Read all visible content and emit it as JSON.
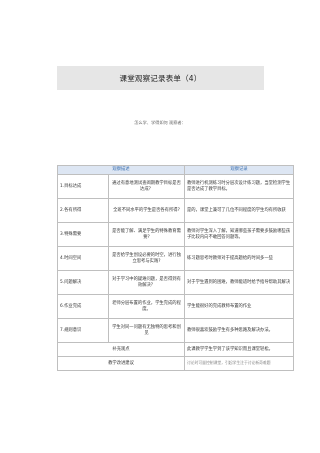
{
  "document": {
    "title": "课堂观察记录表单（4）",
    "meta_line": "怎么学、学得如何  观察者："
  },
  "table": {
    "headers": [
      "观察描述",
      "",
      "观察记录"
    ],
    "rows": [
      {
        "dimension": "1.目标达成",
        "question": "通过有意地测试查阅期教学目标是否达成？",
        "record": "教师进行机测练习时分层次设计练习题，当堂检测学生是否达成了教学目标。"
      },
      {
        "dimension": "2.各有所得",
        "question": "全班不同水平的学生是否各有所得?",
        "record": "是的，课堂上兼可了几位不同程度的学生均有所收获"
      },
      {
        "dimension": "3.特殊需要",
        "question": "是否能了解、满足学生的特殊教育需要?",
        "record": "教师对学生深入了解，知道哪些孩子需要多鼓励哪些孩子比较内向不敢回答问题等。"
      },
      {
        "dimension": "4.时间空间",
        "question": "是否给学生创设必要的时空，进行独立思考与实践?",
        "record": "练习题思考时教师对于提高题给的时间多一些"
      },
      {
        "dimension": "5.问题解决",
        "question": "对于学习中的疑难问题，是否得到有效解决？",
        "record": "对于学生遇到的困难，教师能适时给予指导帮助其解决"
      },
      {
        "dimension": "6.作业完成",
        "question": "老师分层布置的作业，学生完成的程度。",
        "record": "学生能很好的完成教师布置的作业"
      },
      {
        "dimension": "7.规则意识",
        "question": "学生对同一问题有无独特的思考和创见",
        "record": "教师很喜欢鼓励学生有多种思路及解决办法。"
      }
    ],
    "footer_rows": [
      {
        "label": "补充观点",
        "record": "此课教学学生学到了该学知识而且课堂轻松。"
      },
      {
        "label": "教学改进建议",
        "record": "讨论时可量控制课堂，引起学生注于讨论新奇难题"
      }
    ]
  }
}
